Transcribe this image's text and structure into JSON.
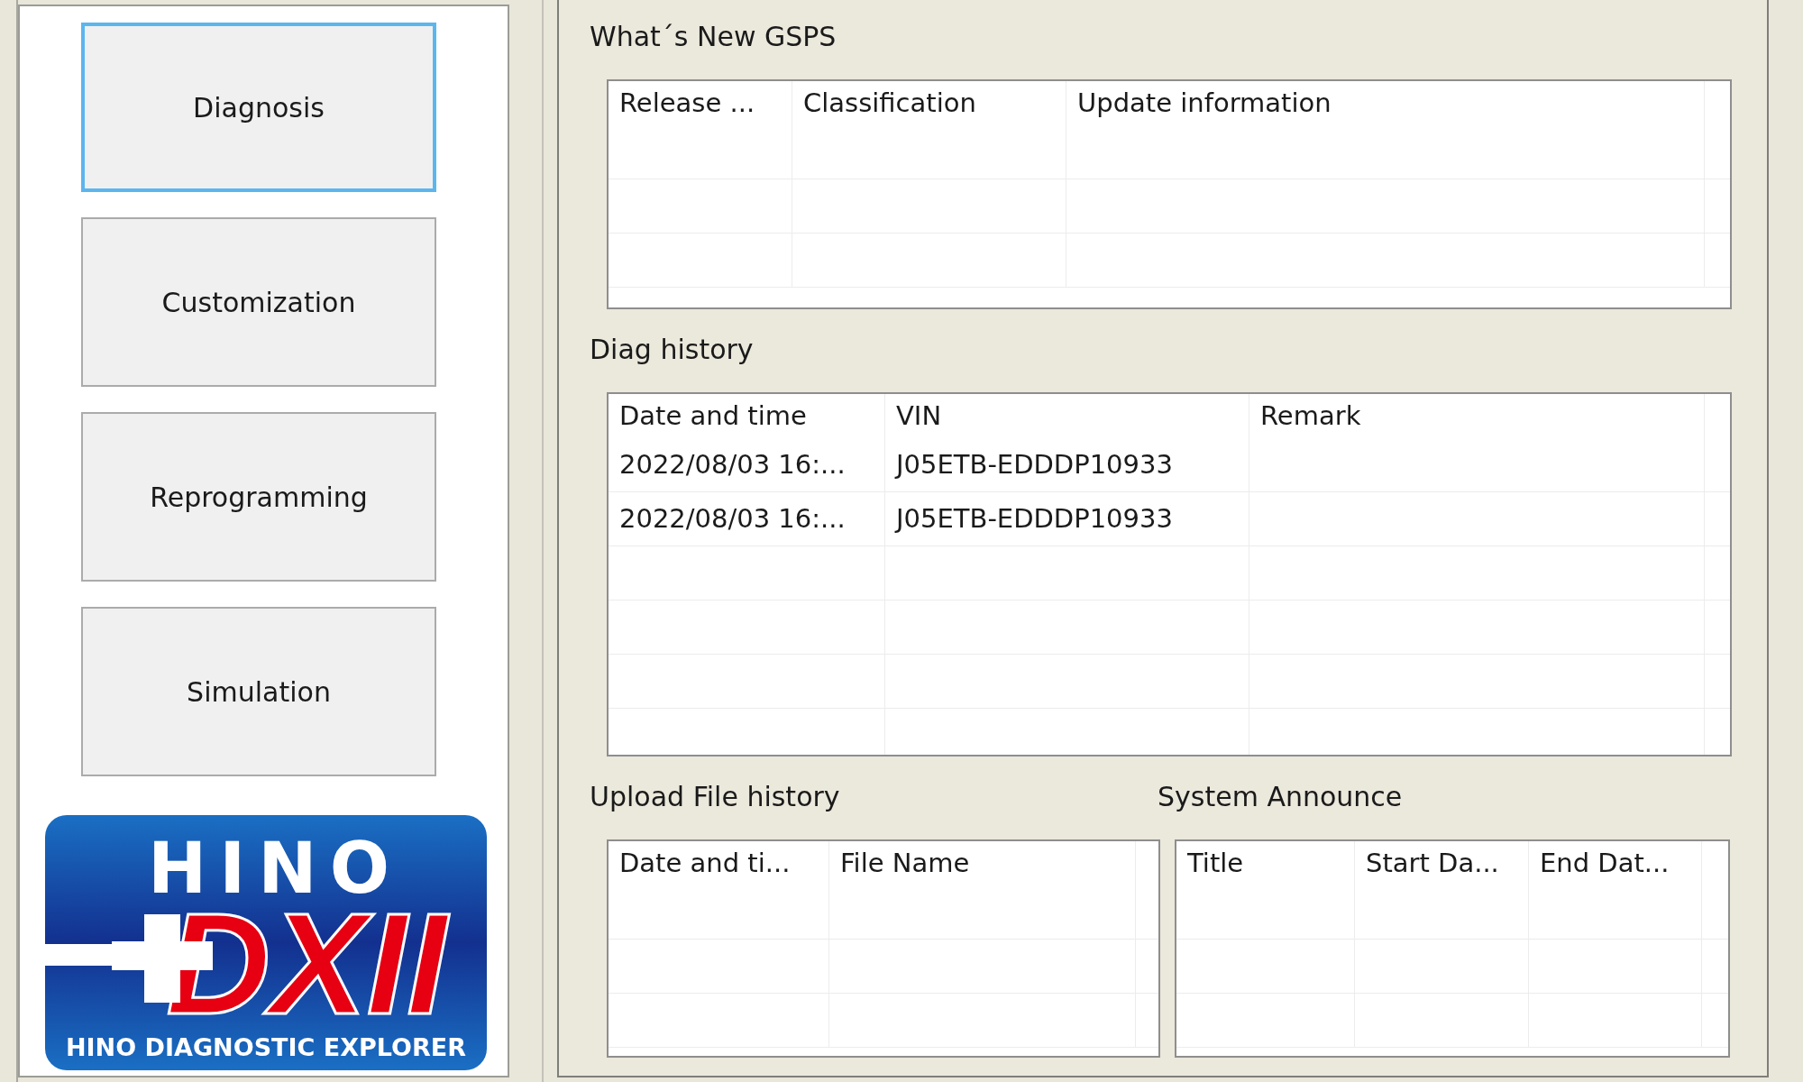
{
  "sidebar": {
    "buttons": [
      {
        "label": "Diagnosis",
        "selected": true
      },
      {
        "label": "Customization",
        "selected": false
      },
      {
        "label": "Reprogramming",
        "selected": false
      },
      {
        "label": "Simulation",
        "selected": false
      }
    ]
  },
  "logo": {
    "brand": "HINO",
    "product": "DXII",
    "tagline": "HINO DIAGNOSTIC EXPLORER"
  },
  "whats_new": {
    "title": "What´s New GSPS",
    "columns": [
      "Release ...",
      "Classification",
      "Update information"
    ]
  },
  "diag_history": {
    "title": "Diag history",
    "columns": [
      "Date and time",
      "VIN",
      "Remark"
    ],
    "rows": [
      [
        "2022/08/03 16:...",
        "J05ETB-EDDDP10933"
      ],
      [
        "2022/08/03 16:...",
        "J05ETB-EDDDP10933"
      ]
    ]
  },
  "upload_file_history": {
    "title": "Upload File history",
    "columns": [
      "Date and ti...",
      "File Name"
    ]
  },
  "system_announce": {
    "title": "System Announce",
    "columns": [
      "Title",
      "Start Da...",
      "End Dat..."
    ]
  }
}
